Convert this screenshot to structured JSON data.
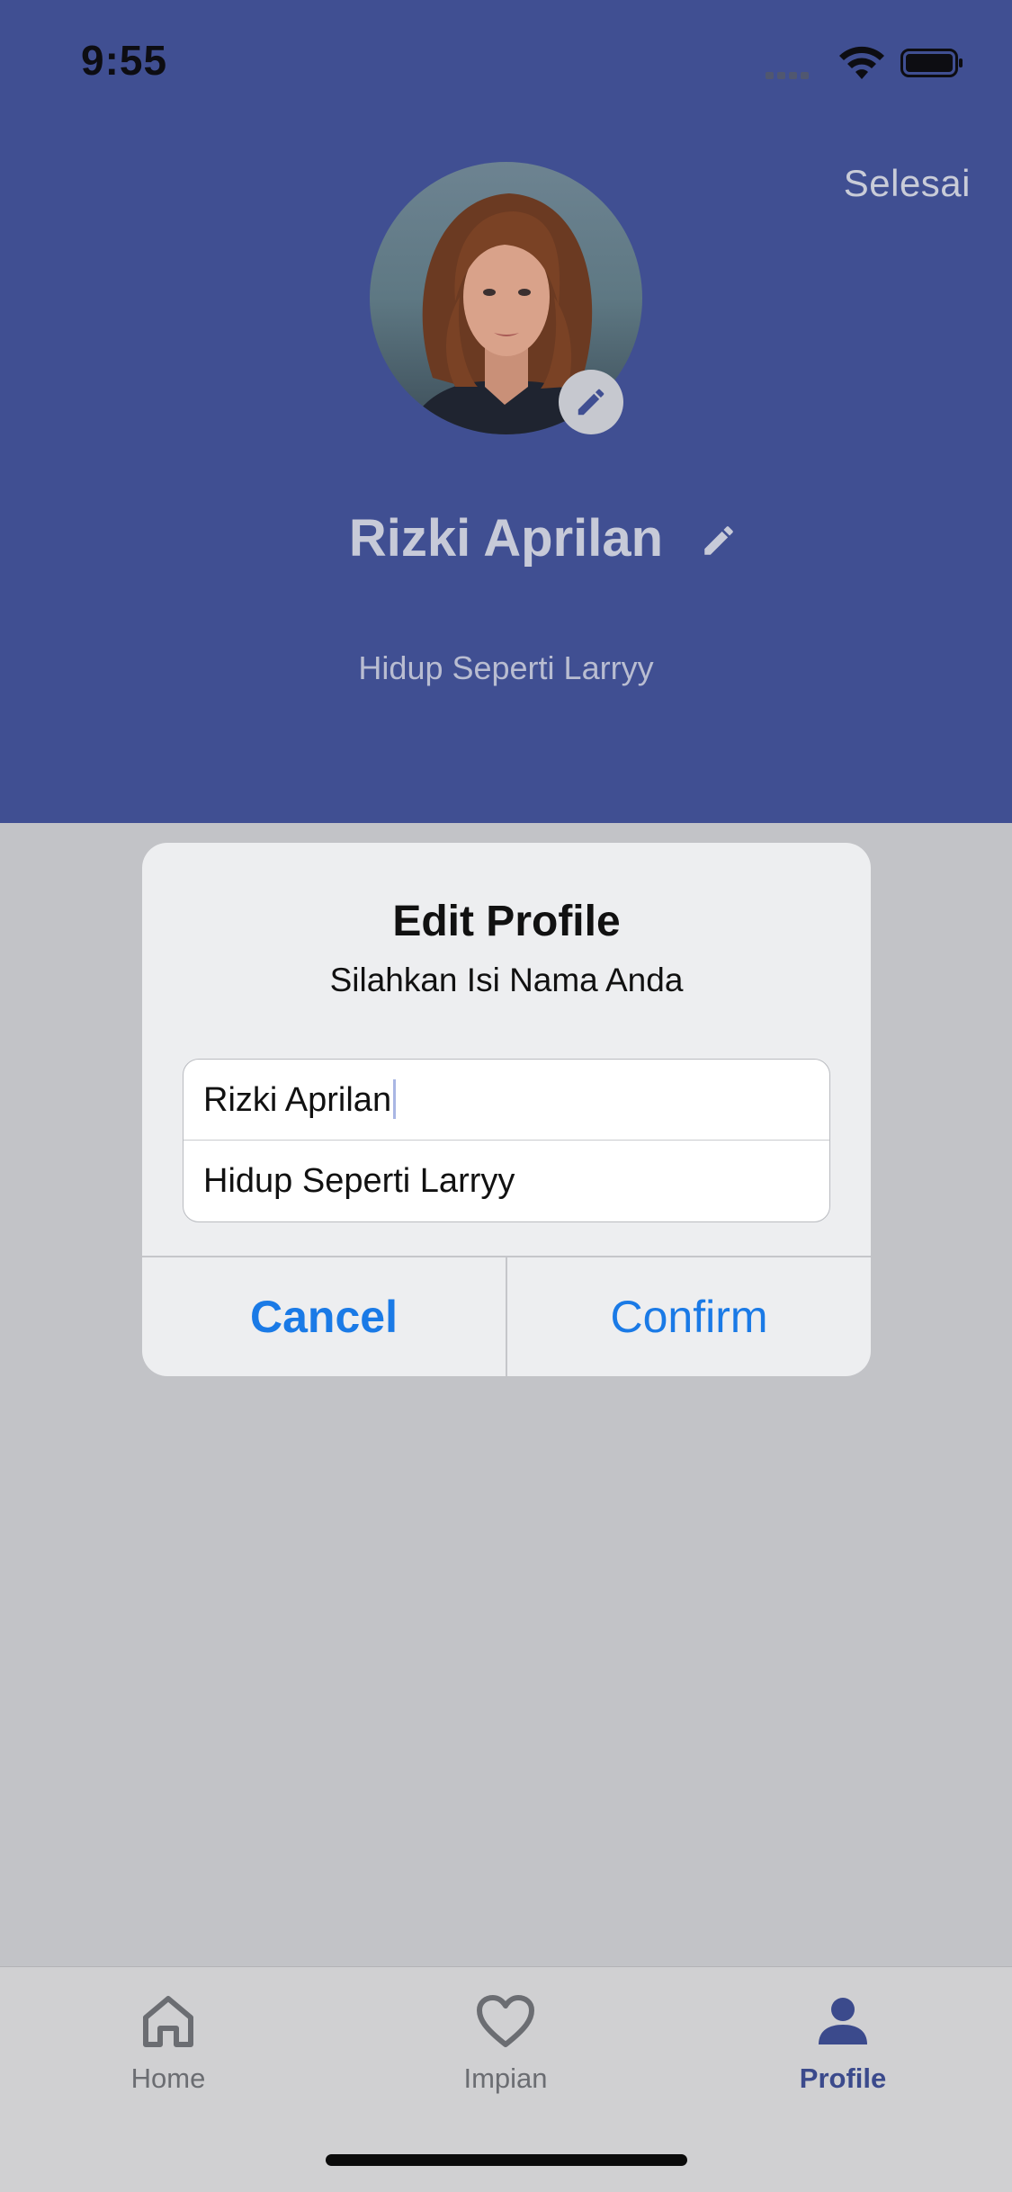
{
  "status_bar": {
    "time": "9:55"
  },
  "header": {
    "done_label": "Selesai",
    "name": "Rizki Aprilan",
    "bio": "Hidup Seperti Larryy"
  },
  "dialog": {
    "title": "Edit Profile",
    "subtitle": "Silahkan Isi Nama Anda",
    "name_value": "Rizki Aprilan",
    "bio_value": "Hidup Seperti Larryy",
    "cancel_label": "Cancel",
    "confirm_label": "Confirm"
  },
  "tab_bar": {
    "items": [
      {
        "label": "Home",
        "icon": "home-icon",
        "active": false
      },
      {
        "label": "Impian",
        "icon": "heart-icon",
        "active": false
      },
      {
        "label": "Profile",
        "icon": "person-icon",
        "active": true
      }
    ]
  },
  "colors": {
    "header_bg": "#404f92",
    "overlay_bg": "#c2c3c7",
    "accent_blue": "#1a7ae6",
    "active_tab": "#3b4a8c"
  }
}
